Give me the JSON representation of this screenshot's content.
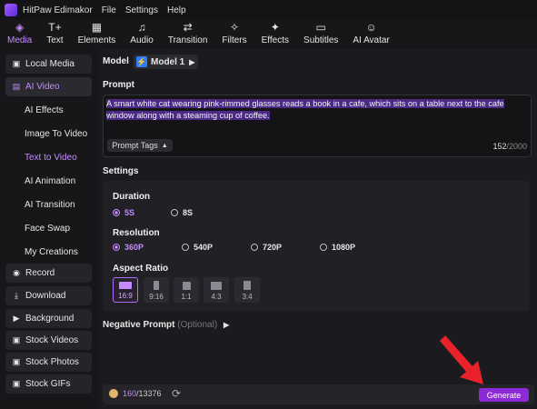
{
  "titlebar": {
    "title": "HitPaw Edimakor",
    "menus": [
      "File",
      "Settings",
      "Help"
    ]
  },
  "tabs": [
    {
      "label": "Media",
      "icon": "media-icon",
      "active": true
    },
    {
      "label": "Text",
      "icon": "text-icon"
    },
    {
      "label": "Elements",
      "icon": "elements-icon"
    },
    {
      "label": "Audio",
      "icon": "music-note-icon"
    },
    {
      "label": "Transition",
      "icon": "transition-icon"
    },
    {
      "label": "Filters",
      "icon": "filters-icon"
    },
    {
      "label": "Effects",
      "icon": "effects-icon"
    },
    {
      "label": "Subtitles",
      "icon": "subtitles-icon"
    },
    {
      "label": "AI Avatar",
      "icon": "avatar-icon"
    }
  ],
  "sidebar": {
    "local_media": "Local Media",
    "ai_video": "AI Video",
    "sub": [
      "AI Effects",
      "Image To Video",
      "Text to Video",
      "AI Animation",
      "AI Transition",
      "Face Swap",
      "My Creations"
    ],
    "record": "Record",
    "download": "Download",
    "background": "Background",
    "stock_videos": "Stock Videos",
    "stock_photos": "Stock Photos",
    "stock_gifs": "Stock GIFs"
  },
  "model": {
    "label": "Model",
    "value": "Model 1"
  },
  "prompt": {
    "label": "Prompt",
    "text": "A smart white cat wearing pink-rimmed glasses reads a book in a cafe, which sits on a table next to the cafe window along with a steaming cup of coffee.",
    "tags_label": "Prompt Tags",
    "count": "152",
    "max": "/2000"
  },
  "settings": {
    "label": "Settings",
    "duration": {
      "label": "Duration",
      "options": [
        "5S",
        "8S"
      ],
      "selected": "5S"
    },
    "resolution": {
      "label": "Resolution",
      "options": [
        "360P",
        "540P",
        "720P",
        "1080P"
      ],
      "selected": "360P"
    },
    "aspect": {
      "label": "Aspect Ratio",
      "options": [
        "16:9",
        "9:16",
        "1:1",
        "4:3",
        "3:4"
      ],
      "selected": "16:9"
    }
  },
  "negative": {
    "label": "Negative Prompt",
    "optional": "(Optional)"
  },
  "credits": {
    "used": "160",
    "total": "/13376"
  },
  "generate_label": "Generate",
  "colors": {
    "accent": "#c58bff",
    "generate": "#8b2ad6",
    "arrow": "#e8212b"
  }
}
